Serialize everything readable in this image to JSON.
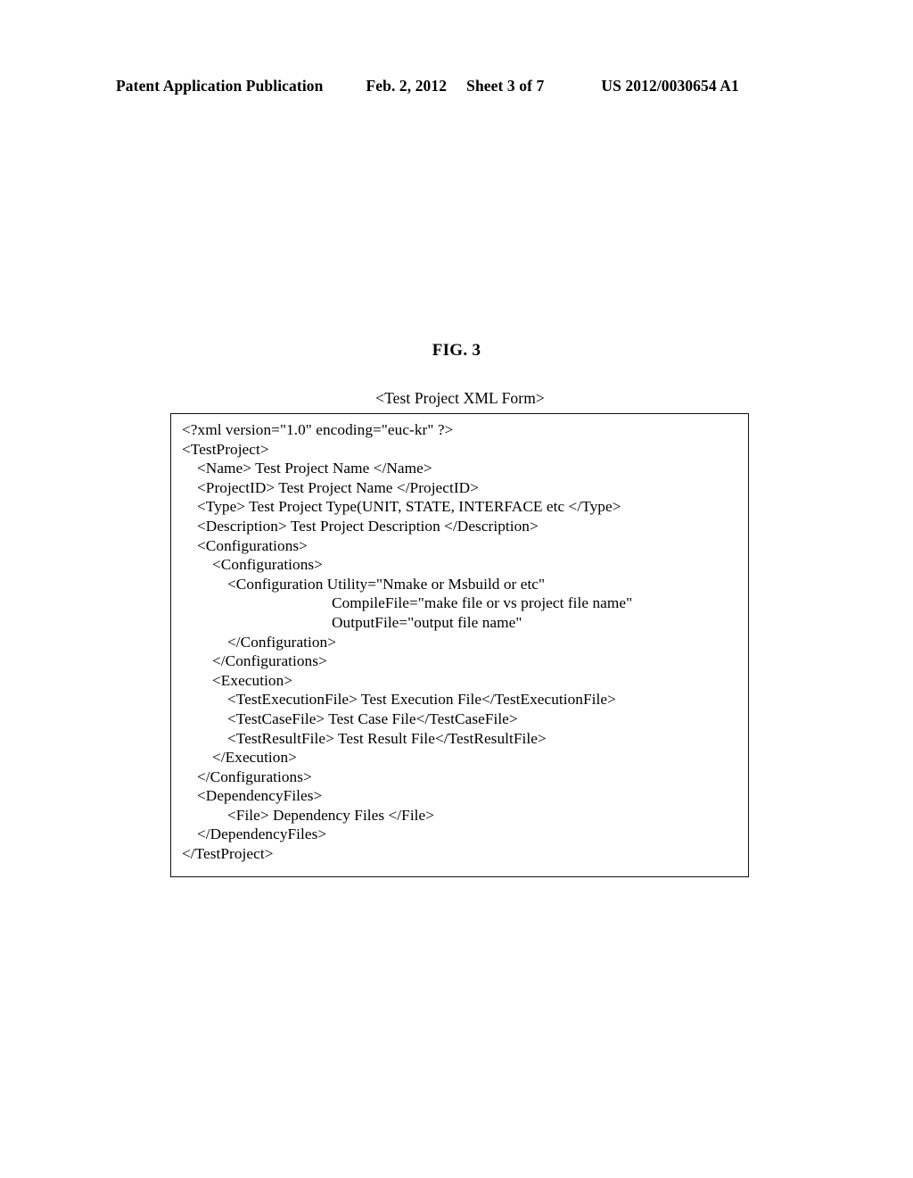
{
  "header": {
    "publication": "Patent Application Publication",
    "date": "Feb. 2, 2012",
    "sheet": "Sheet 3 of 7",
    "doc_number": "US 2012/0030654 A1"
  },
  "figure": {
    "label": "FIG. 3",
    "caption": "<Test Project XML Form>"
  },
  "xml_listing": {
    "lines": [
      {
        "indent": 0,
        "text": "<?xml version=\"1.0\" encoding=\"euc-kr\" ?>"
      },
      {
        "indent": 0,
        "text": "<TestProject>"
      },
      {
        "indent": 1,
        "text": "<Name> Test Project Name </Name>"
      },
      {
        "indent": 1,
        "text": "<ProjectID> Test Project Name </ProjectID>"
      },
      {
        "indent": 1,
        "text": "<Type> Test Project Type(UNIT, STATE, INTERFACE etc </Type>"
      },
      {
        "indent": 1,
        "text": "<Description> Test Project Description </Description>"
      },
      {
        "indent": 1,
        "text": "<Configurations>"
      },
      {
        "indent": 2,
        "text": "<Configurations>"
      },
      {
        "indent": 3,
        "text": "<Configuration Utility=\"Nmake or Msbuild or etc\""
      },
      {
        "indent": 9,
        "text": "CompileFile=\"make file or vs project file name\""
      },
      {
        "indent": 9,
        "text": "OutputFile=\"output file name\""
      },
      {
        "indent": 3,
        "text": "</Configuration>"
      },
      {
        "indent": 2,
        "text": "</Configurations>"
      },
      {
        "indent": 2,
        "text": "<Execution>"
      },
      {
        "indent": 3,
        "text": "<TestExecutionFile> Test Execution File</TestExecutionFile>"
      },
      {
        "indent": 3,
        "text": "<TestCaseFile> Test Case File</TestCaseFile>"
      },
      {
        "indent": 3,
        "text": "<TestResultFile> Test Result File</TestResultFile>"
      },
      {
        "indent": 2,
        "text": "</Execution>"
      },
      {
        "indent": 1,
        "text": "</Configurations>"
      },
      {
        "indent": 1,
        "text": "<DependencyFiles>"
      },
      {
        "indent": 3,
        "text": "<File> Dependency Files </File>"
      },
      {
        "indent": 1,
        "text": "</DependencyFiles>"
      },
      {
        "indent": 0,
        "text": "</TestProject>"
      }
    ]
  }
}
